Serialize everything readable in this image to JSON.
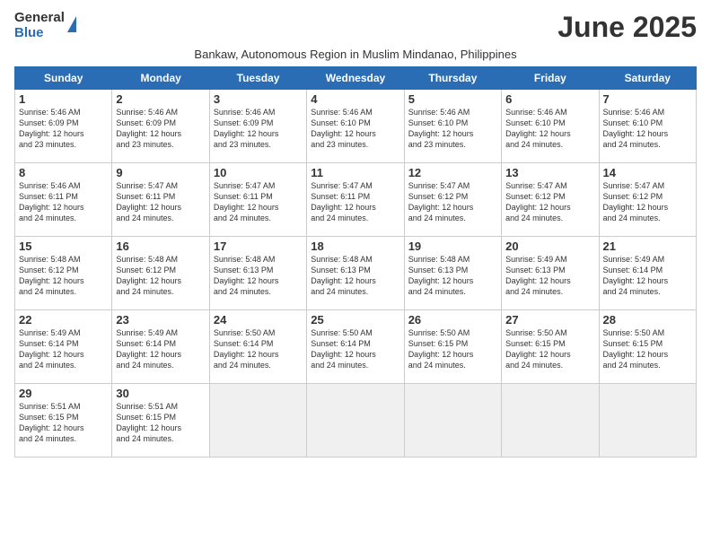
{
  "logo": {
    "general": "General",
    "blue": "Blue"
  },
  "title": "June 2025",
  "subtitle": "Bankaw, Autonomous Region in Muslim Mindanao, Philippines",
  "days": [
    "Sunday",
    "Monday",
    "Tuesday",
    "Wednesday",
    "Thursday",
    "Friday",
    "Saturday"
  ],
  "weeks": [
    [
      {
        "day": "1",
        "sunrise": "5:46 AM",
        "sunset": "6:09 PM",
        "daylight": "12 hours and 23 minutes."
      },
      {
        "day": "2",
        "sunrise": "5:46 AM",
        "sunset": "6:09 PM",
        "daylight": "12 hours and 23 minutes."
      },
      {
        "day": "3",
        "sunrise": "5:46 AM",
        "sunset": "6:09 PM",
        "daylight": "12 hours and 23 minutes."
      },
      {
        "day": "4",
        "sunrise": "5:46 AM",
        "sunset": "6:10 PM",
        "daylight": "12 hours and 23 minutes."
      },
      {
        "day": "5",
        "sunrise": "5:46 AM",
        "sunset": "6:10 PM",
        "daylight": "12 hours and 23 minutes."
      },
      {
        "day": "6",
        "sunrise": "5:46 AM",
        "sunset": "6:10 PM",
        "daylight": "12 hours and 24 minutes."
      },
      {
        "day": "7",
        "sunrise": "5:46 AM",
        "sunset": "6:10 PM",
        "daylight": "12 hours and 24 minutes."
      }
    ],
    [
      {
        "day": "8",
        "sunrise": "5:46 AM",
        "sunset": "6:11 PM",
        "daylight": "12 hours and 24 minutes."
      },
      {
        "day": "9",
        "sunrise": "5:47 AM",
        "sunset": "6:11 PM",
        "daylight": "12 hours and 24 minutes."
      },
      {
        "day": "10",
        "sunrise": "5:47 AM",
        "sunset": "6:11 PM",
        "daylight": "12 hours and 24 minutes."
      },
      {
        "day": "11",
        "sunrise": "5:47 AM",
        "sunset": "6:11 PM",
        "daylight": "12 hours and 24 minutes."
      },
      {
        "day": "12",
        "sunrise": "5:47 AM",
        "sunset": "6:12 PM",
        "daylight": "12 hours and 24 minutes."
      },
      {
        "day": "13",
        "sunrise": "5:47 AM",
        "sunset": "6:12 PM",
        "daylight": "12 hours and 24 minutes."
      },
      {
        "day": "14",
        "sunrise": "5:47 AM",
        "sunset": "6:12 PM",
        "daylight": "12 hours and 24 minutes."
      }
    ],
    [
      {
        "day": "15",
        "sunrise": "5:48 AM",
        "sunset": "6:12 PM",
        "daylight": "12 hours and 24 minutes."
      },
      {
        "day": "16",
        "sunrise": "5:48 AM",
        "sunset": "6:12 PM",
        "daylight": "12 hours and 24 minutes."
      },
      {
        "day": "17",
        "sunrise": "5:48 AM",
        "sunset": "6:13 PM",
        "daylight": "12 hours and 24 minutes."
      },
      {
        "day": "18",
        "sunrise": "5:48 AM",
        "sunset": "6:13 PM",
        "daylight": "12 hours and 24 minutes."
      },
      {
        "day": "19",
        "sunrise": "5:48 AM",
        "sunset": "6:13 PM",
        "daylight": "12 hours and 24 minutes."
      },
      {
        "day": "20",
        "sunrise": "5:49 AM",
        "sunset": "6:13 PM",
        "daylight": "12 hours and 24 minutes."
      },
      {
        "day": "21",
        "sunrise": "5:49 AM",
        "sunset": "6:14 PM",
        "daylight": "12 hours and 24 minutes."
      }
    ],
    [
      {
        "day": "22",
        "sunrise": "5:49 AM",
        "sunset": "6:14 PM",
        "daylight": "12 hours and 24 minutes."
      },
      {
        "day": "23",
        "sunrise": "5:49 AM",
        "sunset": "6:14 PM",
        "daylight": "12 hours and 24 minutes."
      },
      {
        "day": "24",
        "sunrise": "5:50 AM",
        "sunset": "6:14 PM",
        "daylight": "12 hours and 24 minutes."
      },
      {
        "day": "25",
        "sunrise": "5:50 AM",
        "sunset": "6:14 PM",
        "daylight": "12 hours and 24 minutes."
      },
      {
        "day": "26",
        "sunrise": "5:50 AM",
        "sunset": "6:15 PM",
        "daylight": "12 hours and 24 minutes."
      },
      {
        "day": "27",
        "sunrise": "5:50 AM",
        "sunset": "6:15 PM",
        "daylight": "12 hours and 24 minutes."
      },
      {
        "day": "28",
        "sunrise": "5:50 AM",
        "sunset": "6:15 PM",
        "daylight": "12 hours and 24 minutes."
      }
    ],
    [
      {
        "day": "29",
        "sunrise": "5:51 AM",
        "sunset": "6:15 PM",
        "daylight": "12 hours and 24 minutes."
      },
      {
        "day": "30",
        "sunrise": "5:51 AM",
        "sunset": "6:15 PM",
        "daylight": "12 hours and 24 minutes."
      },
      null,
      null,
      null,
      null,
      null
    ]
  ],
  "labels": {
    "sunrise": "Sunrise:",
    "sunset": "Sunset:",
    "daylight": "Daylight:"
  }
}
